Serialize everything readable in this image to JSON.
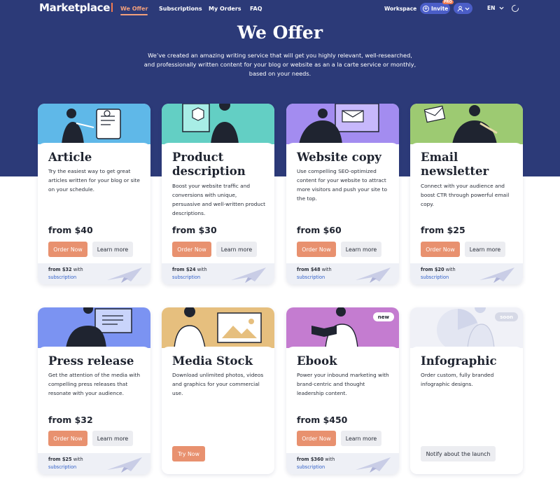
{
  "nav": {
    "logo": "Marketplace",
    "links": [
      "We Offer",
      "Subscriptions",
      "My Orders",
      "FAQ"
    ],
    "workspace": "Workspace",
    "invite": "Invite",
    "invite_badge": "PRO",
    "lang": "EN"
  },
  "hero": {
    "title": "We Offer",
    "subtitle": "We’ve created an amazing writing service that will get you highly relevant, well-researched, and professionally written content for your blog or website as an a la carte service or monthly, based on your needs."
  },
  "cards": [
    {
      "title": "Article",
      "desc": "Try the easiest way to get great articles written for your blog or site on your schedule.",
      "price": "from $40",
      "order": "Order Now",
      "more": "Learn more",
      "sub_price": "from $32",
      "sub_with": "with",
      "sub_link": "subscription",
      "color": "#5fb8e8"
    },
    {
      "title": "Product description",
      "desc": "Boost your website traffic and conversions with unique, persuasive and well-written product descriptions.",
      "price": "from $30",
      "order": "Order Now",
      "more": "Learn more",
      "sub_price": "from $24",
      "sub_with": "with",
      "sub_link": "subscription",
      "color": "#63cfc4"
    },
    {
      "title": "Website copy",
      "desc": "Use compelling SEO-optimized content for your website to attract more visitors and push your site to the top.",
      "price": "from $60",
      "order": "Order Now",
      "more": "Learn more",
      "sub_price": "from $48",
      "sub_with": "with",
      "sub_link": "subscription",
      "color": "#a38cf0"
    },
    {
      "title": "Email newsletter",
      "desc": "Connect with your audience and boost CTR through powerful email copy.",
      "price": "from $25",
      "order": "Order Now",
      "more": "Learn more",
      "sub_price": "from $20",
      "sub_with": "with",
      "sub_link": "subscription",
      "color": "#9dca72"
    },
    {
      "title": "Press release",
      "desc": "Get the attention of the media with compelling press releases that resonate with your audience.",
      "price": "from $32",
      "order": "Order Now",
      "more": "Learn more",
      "sub_price": "from $25",
      "sub_with": "with",
      "sub_link": "subscription",
      "color": "#7b93f2"
    },
    {
      "title": "Media Stock",
      "desc": "Download unlimited photos, videos and graphics for your commercial use.",
      "try": "Try Now",
      "color": "#e6bf7e"
    },
    {
      "title": "Ebook",
      "desc": "Power your inbound marketing with brand-centric and thought leadership content.",
      "price": "from $450",
      "order": "Order Now",
      "more": "Learn more",
      "sub_price": "from $360",
      "sub_with": "with",
      "sub_link": "subscription",
      "tag": "new",
      "color": "#c47cd0"
    },
    {
      "title": "Infographic",
      "desc": "Order custom, fully branded infographic designs.",
      "notify": "Notify about the launch",
      "tag": "soon",
      "color": "#f0f1f7"
    }
  ]
}
